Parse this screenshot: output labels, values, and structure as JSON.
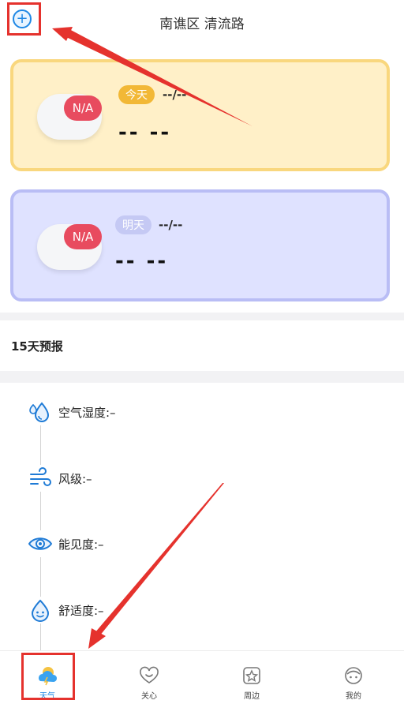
{
  "header": {
    "location": "南谯区 清流路",
    "add_glyph": "+"
  },
  "today": {
    "badge": "N/A",
    "day_label": "今天",
    "temp_range": "--/--",
    "condition": "-- --"
  },
  "tomorrow": {
    "badge": "N/A",
    "day_label": "明天",
    "temp_range": "--/--",
    "condition": "-- --"
  },
  "forecast": {
    "title": "15天预报"
  },
  "details": [
    {
      "label": "空气湿度:–",
      "icon": "humidity-icon"
    },
    {
      "label": "风级:–",
      "icon": "wind-icon"
    },
    {
      "label": "能见度:–",
      "icon": "visibility-icon"
    },
    {
      "label": "舒适度:–",
      "icon": "comfort-icon"
    }
  ],
  "tabs": [
    {
      "label": "天气",
      "icon": "weather-icon",
      "active": true
    },
    {
      "label": "关心",
      "icon": "care-icon"
    },
    {
      "label": "周边",
      "icon": "nearby-icon"
    },
    {
      "label": "我的",
      "icon": "profile-icon"
    }
  ],
  "colors": {
    "accent": "#1f88e5",
    "annotation": "#e5322d",
    "today_bg": "#fff0c8",
    "tomorrow_bg": "#dfe2ff",
    "badge": "#e84b5f"
  }
}
